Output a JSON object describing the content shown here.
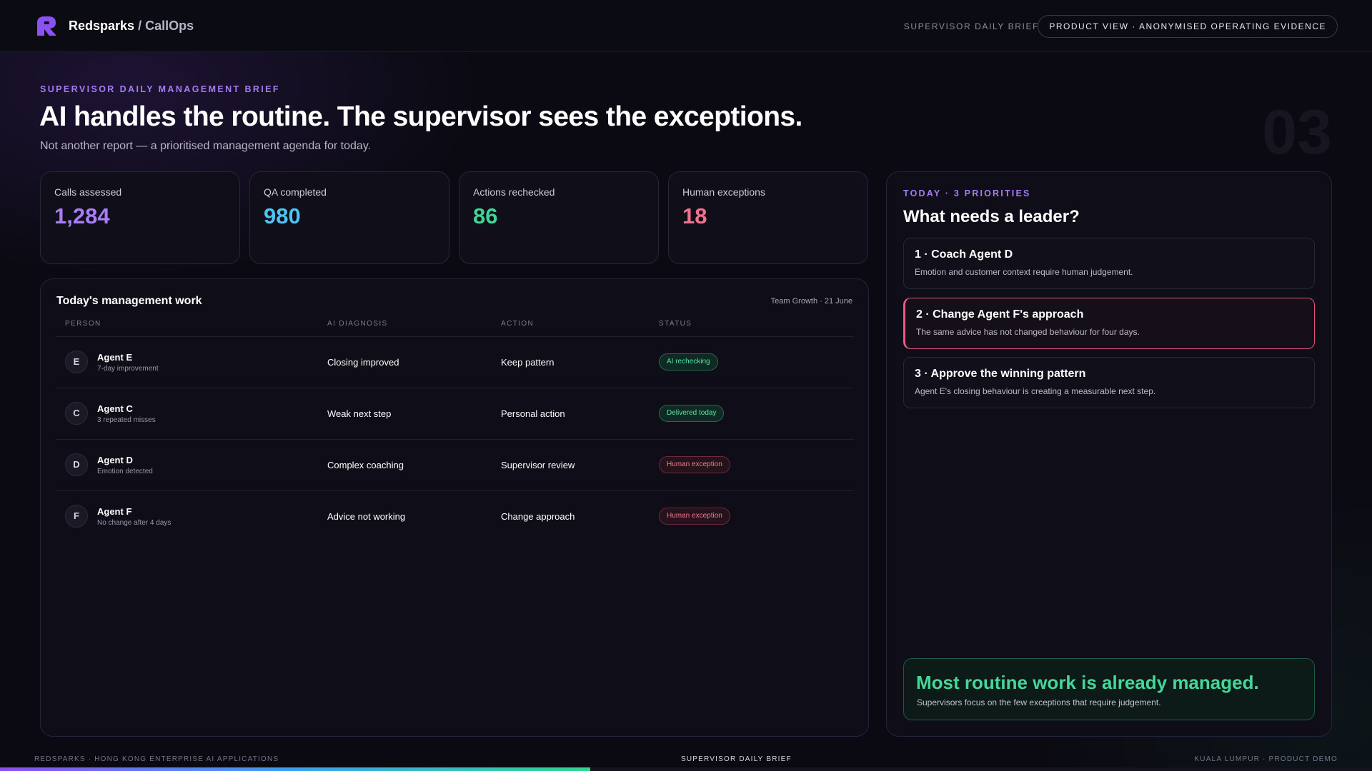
{
  "header": {
    "brand": "Redsparks",
    "brand_sub": "/ CallOps",
    "nav_label": "SUPERVISOR DAILY BRIEF",
    "view_pill": "PRODUCT VIEW · ANONYMISED OPERATING EVIDENCE"
  },
  "hero": {
    "eyebrow": "SUPERVISOR DAILY MANAGEMENT BRIEF",
    "title": "AI handles the routine. The supervisor sees the exceptions.",
    "subtitle": "Not another report — a prioritised management agenda for today.",
    "page_number": "03"
  },
  "kpis": [
    {
      "label": "Calls assessed",
      "value": "1,284",
      "color": "#a87ef8"
    },
    {
      "label": "QA completed",
      "value": "980",
      "color": "#4cc4f2"
    },
    {
      "label": "Actions rechecked",
      "value": "86",
      "color": "#41d494"
    },
    {
      "label": "Human exceptions",
      "value": "18",
      "color": "#f2718e"
    }
  ],
  "work": {
    "title": "Today's management work",
    "meta": "Team Growth · 21 June",
    "columns": [
      "PERSON",
      "AI DIAGNOSIS",
      "ACTION",
      "STATUS"
    ],
    "rows": [
      {
        "initial": "E",
        "name": "Agent E",
        "note": "7-day improvement",
        "diagnosis": "Closing improved",
        "action": "Keep pattern",
        "status": "AI rechecking",
        "status_tone": "green"
      },
      {
        "initial": "C",
        "name": "Agent C",
        "note": "3 repeated misses",
        "diagnosis": "Weak next step",
        "action": "Personal action",
        "status": "Delivered today",
        "status_tone": "green"
      },
      {
        "initial": "D",
        "name": "Agent D",
        "note": "Emotion detected",
        "diagnosis": "Complex coaching",
        "action": "Supervisor review",
        "status": "Human exception",
        "status_tone": "red"
      },
      {
        "initial": "F",
        "name": "Agent F",
        "note": "No change after 4 days",
        "diagnosis": "Advice not working",
        "action": "Change approach",
        "status": "Human exception",
        "status_tone": "red"
      }
    ]
  },
  "priorities": {
    "eyebrow": "TODAY · 3 PRIORITIES",
    "title": "What needs a leader?",
    "items": [
      {
        "title": "1 · Coach Agent D",
        "desc": "Emotion and customer context require human judgement."
      },
      {
        "title": "2 · Change Agent F's approach",
        "desc": "The same advice has not changed behaviour for four days."
      },
      {
        "title": "3 · Approve the winning pattern",
        "desc": "Agent E's closing behaviour is creating a measurable next step."
      }
    ],
    "callout_title": "Most routine work is already managed.",
    "callout_sub": "Supervisors focus on the few exceptions that require judgement."
  },
  "footer": {
    "left": "REDSPARKS · HONG KONG ENTERPRISE AI APPLICATIONS",
    "center": "SUPERVISOR DAILY BRIEF",
    "right": "KUALA LUMPUR · PRODUCT DEMO",
    "progress_fraction": 0.43
  }
}
